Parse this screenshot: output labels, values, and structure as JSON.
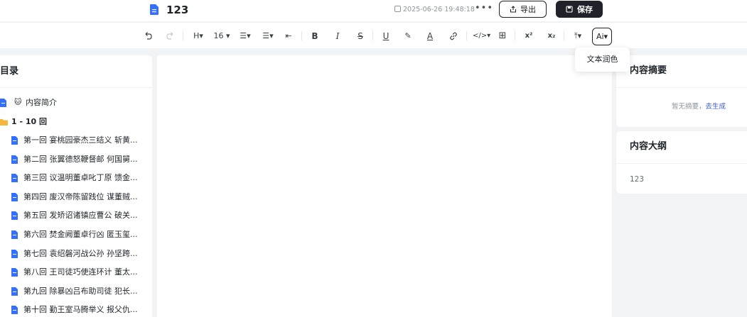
{
  "header": {
    "doc_title": "123",
    "save_time": "2025-06-26 19:48:18",
    "more": "•••",
    "export_label": "导出",
    "save_label": "保存"
  },
  "toolbar": {
    "heading": "H▾",
    "font_size": "16 ▾",
    "bullet_list": "☰▾",
    "align": "☰▾",
    "indent": "⇤",
    "bold": "B",
    "italic": "I",
    "strike": "S",
    "underline": "U",
    "highlight": "✎",
    "font_color": "A",
    "link": "🔗",
    "code": "</>▾",
    "table": "⊞",
    "superscript": "x²",
    "subscript": "x₂",
    "upload": "⤒▾",
    "ai": "Ai▾"
  },
  "tooltip": {
    "label": "文本润色"
  },
  "sidebar": {
    "title": "目录",
    "intro": "内容简介",
    "folder": "1 - 10 回",
    "chapters": [
      "第一回 宴桃园豪杰三结义 斩黄...",
      "第二回 张翼德怒鞭督邮 何国舅...",
      "第三回 议温明董卓叱丁原 馈金...",
      "第四回 废汉帝陈留践位 谋董贼...",
      "第五回 发矫诏诸镇应曹公 破关...",
      "第六回 焚金阙董卓行凶 匿玉玺...",
      "第七回 袁绍磐河战公孙 孙坚跨...",
      "第八回 王司徒巧使连环计 董太...",
      "第九回 除暴凶吕布助司徒 犯长...",
      "第十回 勤王室马腾举义 报父仇..."
    ]
  },
  "summary": {
    "title": "内容摘要",
    "empty_text": "暂无摘要，",
    "generate_link": "去生成"
  },
  "outline": {
    "title": "内容大纲",
    "item": "123"
  },
  "colors": {
    "accent": "#1f2329",
    "link": "#3b5bdb",
    "doc_icon": "#3370ff",
    "folder_icon": "#f5b83d"
  }
}
